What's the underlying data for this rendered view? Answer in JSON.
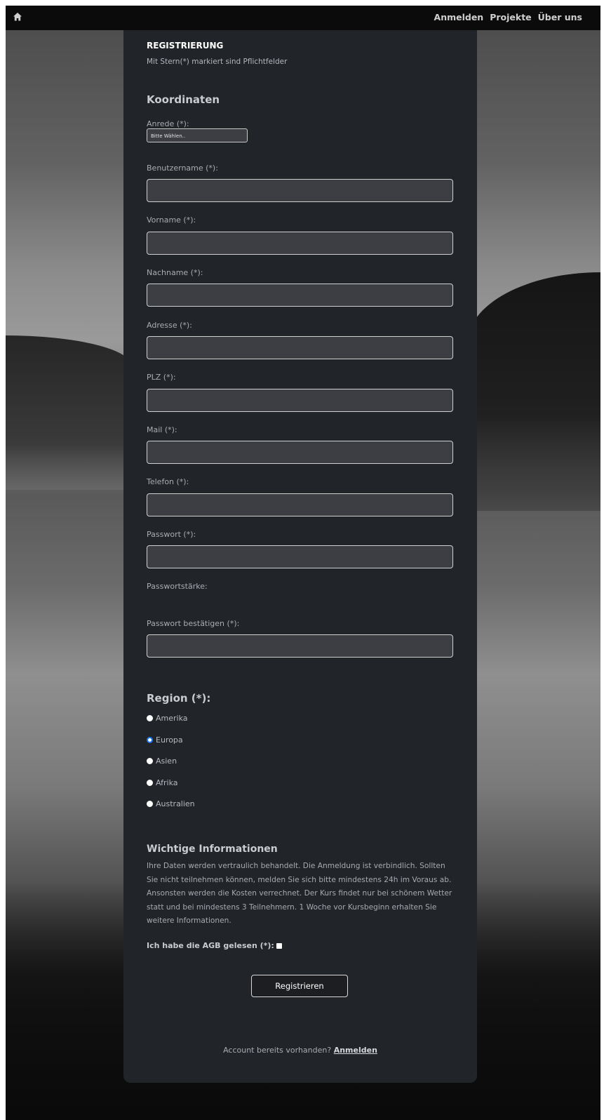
{
  "nav": {
    "home_icon": "home-icon",
    "links": [
      "Anmelden",
      "Projekte",
      "Über uns"
    ]
  },
  "form": {
    "title": "REGISTRIERUNG",
    "subtitle": "Mit Stern(*) markiert sind Pflichtfelder",
    "section_title": "Koordinaten",
    "salutation": {
      "label": "Anrede (*):",
      "value": "Bitte Wählen.."
    },
    "fields": {
      "username": {
        "label": "Benutzername (*):",
        "value": ""
      },
      "firstname": {
        "label": "Vorname (*):",
        "value": ""
      },
      "lastname": {
        "label": "Nachname (*):",
        "value": ""
      },
      "address": {
        "label": "Adresse (*):",
        "value": ""
      },
      "zip": {
        "label": "PLZ (*):",
        "value": ""
      },
      "mail": {
        "label": "Mail (*):",
        "value": ""
      },
      "phone": {
        "label": "Telefon (*):",
        "value": ""
      },
      "password": {
        "label": "Passwort (*):",
        "value": ""
      },
      "password_confirm": {
        "label": "Passwort bestätigen (*):",
        "value": ""
      }
    },
    "password_strength_label": "Passwortstärke:",
    "region": {
      "title": "Region (*):",
      "options": [
        "Amerika",
        "Europa",
        "Asien",
        "Afrika",
        "Australien"
      ],
      "selected": "Europa"
    },
    "info": {
      "title": "Wichtige Informationen",
      "text": "Ihre Daten werden vertraulich behandelt. Die Anmeldung ist verbindlich. Sollten Sie nicht teilnehmen können, melden Sie sich bitte mindestens 24h im Voraus ab. Ansonsten werden die Kosten verrechnet. Der Kurs findet nur bei schönem Wetter statt und bei mindestens 3 Teilnehmern. 1 Woche vor Kursbeginn erhalten Sie weitere Informationen."
    },
    "agb_label": "Ich habe die AGB gelesen (*):",
    "agb_checked": false,
    "submit_label": "Registrieren",
    "account_text": "Account bereits vorhanden?",
    "account_link": "Anmelden"
  },
  "colors": {
    "panel": "#212428",
    "input_bg": "#3c3e43",
    "navbar": "#0b0b0b",
    "radio_selected": "#1a73e8"
  }
}
